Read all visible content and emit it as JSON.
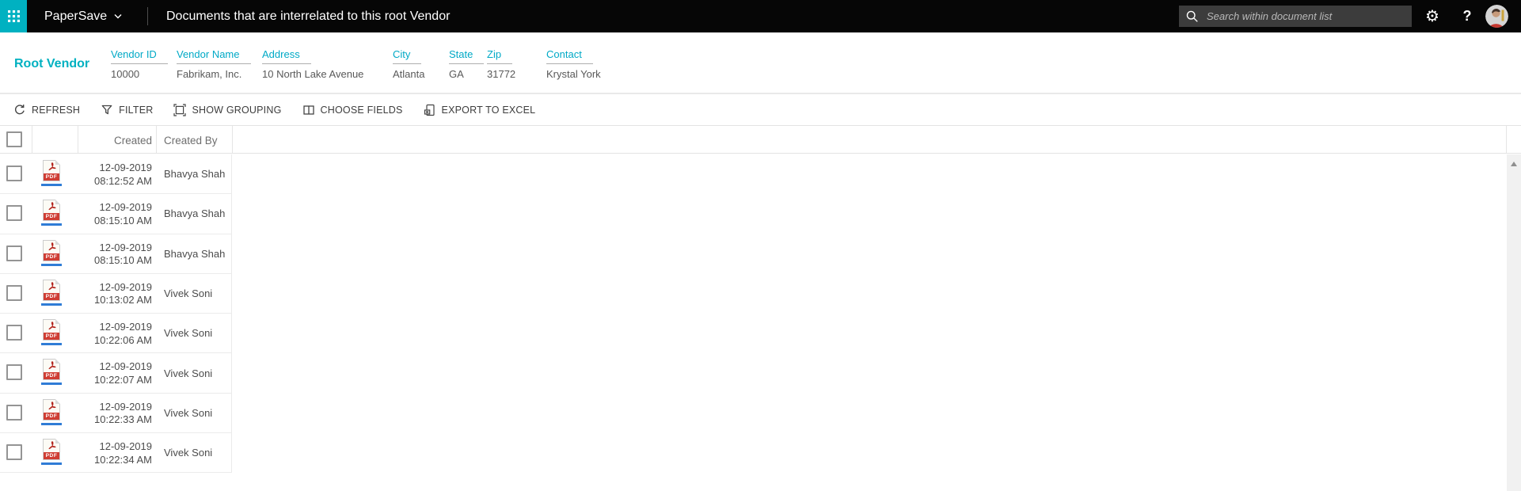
{
  "topbar": {
    "app_name": "PaperSave",
    "page_title": "Documents that are interrelated to this root Vendor",
    "search": {
      "placeholder": "Search within document list"
    },
    "icons": {
      "settings_glyph": "⚙",
      "help_glyph": "?"
    }
  },
  "vendor_panel": {
    "title": "Root Vendor",
    "fields": [
      {
        "label": "Vendor ID",
        "value": "10000"
      },
      {
        "label": "Vendor Name",
        "value": "Fabrikam, Inc."
      },
      {
        "label": "Address",
        "value": "10 North Lake Avenue"
      },
      {
        "label": "City",
        "value": "Atlanta"
      },
      {
        "label": "State",
        "value": "GA"
      },
      {
        "label": "Zip",
        "value": "31772"
      },
      {
        "label": "Contact",
        "value": "Krystal York"
      }
    ]
  },
  "toolbar": {
    "buttons": [
      {
        "label": "REFRESH"
      },
      {
        "label": "FILTER"
      },
      {
        "label": "SHOW GROUPING"
      },
      {
        "label": "CHOOSE FIELDS"
      },
      {
        "label": "EXPORT TO EXCEL"
      }
    ]
  },
  "doc_table": {
    "header": {
      "created": "Created",
      "created_by": "Created By"
    },
    "pdf_badge": "PDF",
    "rows": [
      {
        "date": "12-09-2019",
        "time": "08:12:52 AM",
        "created_by": "Bhavya Shah"
      },
      {
        "date": "12-09-2019",
        "time": "08:15:10 AM",
        "created_by": "Bhavya Shah"
      },
      {
        "date": "12-09-2019",
        "time": "08:15:10 AM",
        "created_by": "Bhavya Shah"
      },
      {
        "date": "12-09-2019",
        "time": "10:13:02 AM",
        "created_by": "Vivek Soni"
      },
      {
        "date": "12-09-2019",
        "time": "10:22:06 AM",
        "created_by": "Vivek Soni"
      },
      {
        "date": "12-09-2019",
        "time": "10:22:07 AM",
        "created_by": "Vivek Soni"
      },
      {
        "date": "12-09-2019",
        "time": "10:22:33 AM",
        "created_by": "Vivek Soni"
      },
      {
        "date": "12-09-2019",
        "time": "10:22:34 AM",
        "created_by": "Vivek Soni"
      }
    ]
  },
  "colors": {
    "accent_teal": "#00b1c1",
    "pdf_red": "#cf3d33",
    "link_blue": "#2f7cd6",
    "topbar_bg": "#060606"
  }
}
